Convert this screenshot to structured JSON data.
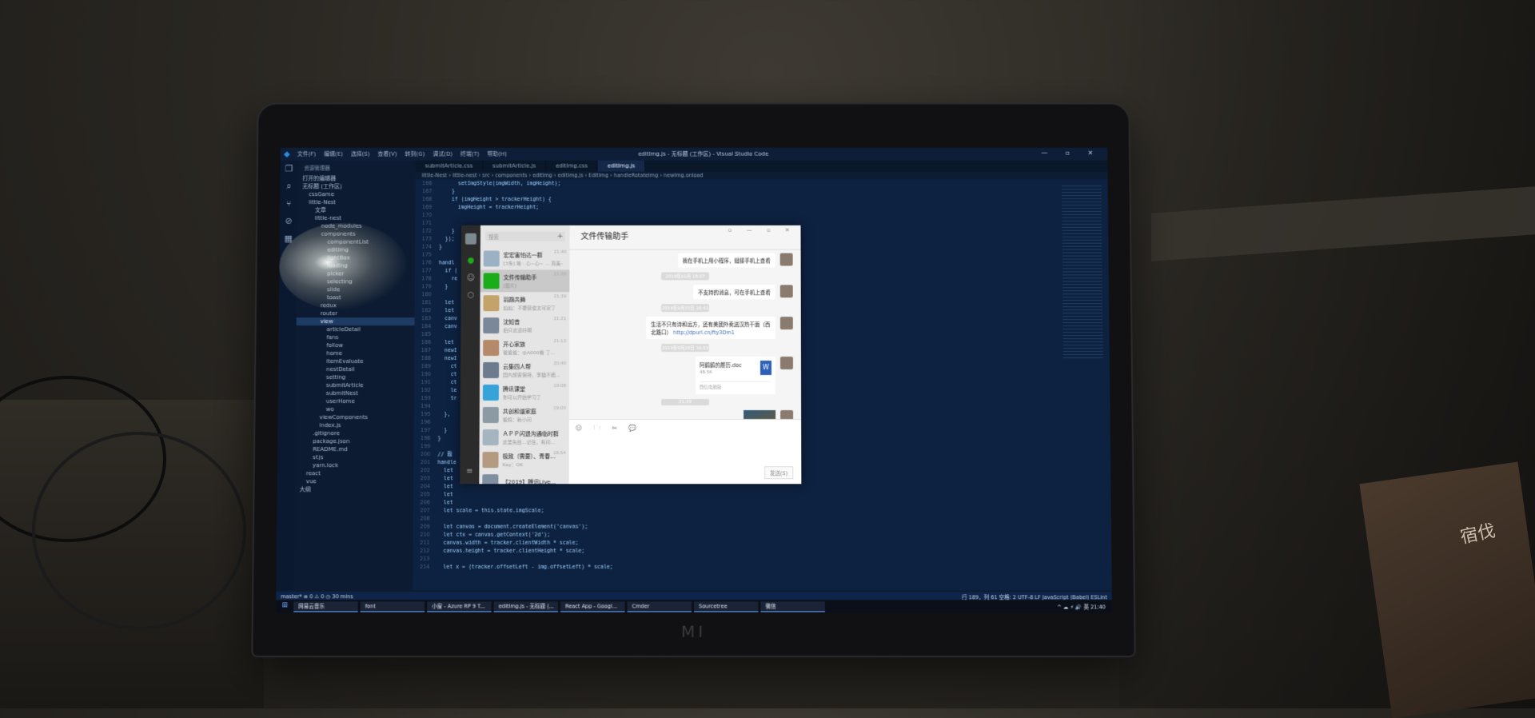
{
  "vscode": {
    "menu": [
      "文件(F)",
      "编辑(E)",
      "选择(S)",
      "查看(V)",
      "转到(G)",
      "调试(D)",
      "终端(T)",
      "帮助(H)"
    ],
    "window_title": "editImg.js - 无标题 (工作区) - Visual Studio Code",
    "window_controls": "— ▫ ✕",
    "explorer_header": "资源管理器",
    "tabs": [
      {
        "label": "submitArticle.css",
        "active": false
      },
      {
        "label": "submitArticle.js",
        "active": false
      },
      {
        "label": "editImg.css",
        "active": false
      },
      {
        "label": "editImg.js",
        "active": true
      }
    ],
    "breadcrumb": "little-Nest › little-nest › src › components › editImg › editImg.js › EditImg › handleRotateImg › newImg.onload",
    "tree": [
      {
        "label": "打开的编辑器",
        "indent": 0
      },
      {
        "label": "无标题 (工作区)",
        "indent": 0
      },
      {
        "label": "cssGame",
        "indent": 1
      },
      {
        "label": "little-Nest",
        "indent": 1
      },
      {
        "label": "文章",
        "indent": 2
      },
      {
        "label": "little-nest",
        "indent": 2
      },
      {
        "label": "node_modules",
        "indent": 3
      },
      {
        "label": "components",
        "indent": 3
      },
      {
        "label": "componentList",
        "indent": 4
      },
      {
        "label": "editImg",
        "indent": 4
      },
      {
        "label": "lightBox",
        "indent": 4
      },
      {
        "label": "loading",
        "indent": 4
      },
      {
        "label": "picker",
        "indent": 4
      },
      {
        "label": "selecting",
        "indent": 4
      },
      {
        "label": "slide",
        "indent": 4
      },
      {
        "label": "toast",
        "indent": 4
      },
      {
        "label": "redux",
        "indent": 3
      },
      {
        "label": "router",
        "indent": 3
      },
      {
        "label": "view",
        "indent": 3,
        "selected": true
      },
      {
        "label": "articleDetail",
        "indent": 4
      },
      {
        "label": "fans",
        "indent": 4
      },
      {
        "label": "follow",
        "indent": 4
      },
      {
        "label": "home",
        "indent": 4
      },
      {
        "label": "itemEvaluate",
        "indent": 4
      },
      {
        "label": "nestDetail",
        "indent": 4
      },
      {
        "label": "setting",
        "indent": 4
      },
      {
        "label": "submitArticle",
        "indent": 4
      },
      {
        "label": "submitNest",
        "indent": 4
      },
      {
        "label": "userHome",
        "indent": 4
      },
      {
        "label": "wo",
        "indent": 4
      },
      {
        "label": "viewComponents",
        "indent": 3
      },
      {
        "label": "index.js",
        "indent": 3
      },
      {
        "label": ".gitignore",
        "indent": 2
      },
      {
        "label": "package.json",
        "indent": 2
      },
      {
        "label": "README.md",
        "indent": 2
      },
      {
        "label": "sf.js",
        "indent": 2
      },
      {
        "label": "yarn.lock",
        "indent": 2
      },
      {
        "label": "react",
        "indent": 1
      },
      {
        "label": "vue",
        "indent": 1
      },
      {
        "label": "大纲",
        "indent": 0
      }
    ],
    "gutter": [
      "166",
      "167",
      "168",
      "169",
      "170",
      "171",
      "172",
      "173",
      "174",
      "175",
      "176",
      "177",
      "178",
      "179",
      "180",
      "181",
      "182",
      "183",
      "184",
      "185",
      "186",
      "187",
      "188",
      "189",
      "190",
      "191",
      "192",
      "193",
      "194",
      "195",
      "196",
      "197",
      "198",
      "199",
      "200",
      "201",
      "202",
      "203",
      "204",
      "205",
      "206",
      "207",
      "208",
      "209",
      "210",
      "211",
      "212",
      "213",
      "214"
    ],
    "code_lines": [
      "      setImgStyle(imgWidth, imgHeight);",
      "    }",
      "    if (imgHeight > trackerHeight) {",
      "      imgHeight = trackerHeight;",
      "",
      "",
      "    }",
      "  });",
      "}",
      "",
      "handl",
      "  if (",
      "    re",
      "  }",
      "",
      "  let",
      "  let",
      "  canv",
      "  canv",
      "",
      "  let",
      "  newI",
      "  newI",
      "    ct",
      "    ct",
      "    ct",
      "    le",
      "    tr",
      "",
      "  },",
      "",
      "  }",
      "}",
      "",
      "// 裁",
      "handle",
      "  let",
      "  let",
      "  let",
      "  let",
      "  let",
      "  let scale = this.state.imgScale;",
      "",
      "  let canvas = document.createElement('canvas');",
      "  let ctx = canvas.getContext('2d');",
      "  canvas.width = tracker.clientWidth * scale;",
      "  canvas.height = tracker.clientHeight * scale;",
      "",
      "  let x = (tracker.offsetLeft - img.offsetLeft) * scale;"
    ],
    "status_left": "master*  ⊗ 0 ⚠ 0  ◷ 30 mins",
    "status_right": "行 189，列 61   空格: 2   UTF-8   LF   JavaScript (Babel)   ESLint"
  },
  "taskbar": {
    "start": "⊞",
    "items": [
      "网易云音乐",
      "font",
      "小窗 - Azure RP 9 T...",
      "editImg.js - 无标题 (...",
      "React App - Googl...",
      "Cmder",
      "Sourcetree",
      "微信"
    ],
    "tray": "^ ☁ ⚡ 🔊 英  21:40"
  },
  "wechat": {
    "search_placeholder": "搜索",
    "plus": "+",
    "chat_title": "文件传输助手",
    "controls": "▫ — ▫ ✕",
    "conversations": [
      {
        "name": "宏宏害怕达一群",
        "msg": "[3条] 晰 : 心~心~ ... 真美~",
        "time": "21:40",
        "color": "#9bb2c4",
        "selected": false
      },
      {
        "name": "文件传输助手",
        "msg": "[图片]",
        "time": "21:39",
        "color": "#1aad19",
        "selected": true
      },
      {
        "name": "羽鵡共舞",
        "msg": "灿灿：不要装傻太可定了",
        "time": "21:39",
        "color": "#c4a36b",
        "selected": false
      },
      {
        "name": "沈知昔",
        "msg": "拍只这道好啊",
        "time": "21:21",
        "color": "#7a8899",
        "selected": false
      },
      {
        "name": "开心家族",
        "msg": "爸爸爸：@A000看  了...",
        "time": "21:13",
        "color": "#b58a6a",
        "selected": false
      },
      {
        "name": "云集四人帮",
        "msg": "国內旅客保持，李猫不能...",
        "time": "20:40",
        "color": "#6d7b8f",
        "selected": false
      },
      {
        "name": "腾讯课堂",
        "msg": "你可以开始学习了",
        "time": "19:08",
        "color": "#36a3d9",
        "selected": false
      },
      {
        "name": "共创和谐家庭",
        "msg": "爸妈：新小问",
        "time": "19:00",
        "color": "#8c9aa3",
        "selected": false
      },
      {
        "name": "ＡＰＰ闪退沟通临时群",
        "msg": "这里先给...记住，有问...",
        "time": "",
        "color": "#a5b4c1",
        "selected": false
      },
      {
        "name": "极致（需要）、青春...",
        "msg": "Kay：OK",
        "time": "18:54",
        "color": "#b39a80",
        "selected": false
      },
      {
        "name": "【2019】腾讯Live...",
        "msg": "",
        "time": "",
        "color": "#7f8fa0",
        "selected": false
      }
    ],
    "messages": [
      {
        "type": "text",
        "text": "我在手机上用小程序，鏈接手机上查看"
      },
      {
        "type": "time",
        "text": "2019年10月 18:07"
      },
      {
        "type": "text",
        "text": "不支持的消息，可在手机上查看"
      },
      {
        "type": "time",
        "text": "2019年9月15日 16:41"
      },
      {
        "type": "text",
        "text": "生活不只有诗和远方，还有美团外卖送汉热干面（西北路口）",
        "link": "http://dpurl.cn/fty3Dm1"
      },
      {
        "type": "time",
        "text": "2019年9月28日 16:53"
      },
      {
        "type": "file",
        "name": "阿鹤鹤的履历.doc",
        "size": "48.5K",
        "note": "微信电脑版"
      },
      {
        "type": "time",
        "text": "21:39"
      },
      {
        "type": "image"
      }
    ],
    "input_tools": "☺ 🗀 ✂ 💬",
    "send_label": "发送(S)"
  },
  "scene": {
    "laptop_brand": "MI",
    "box_label": "宿伐"
  }
}
